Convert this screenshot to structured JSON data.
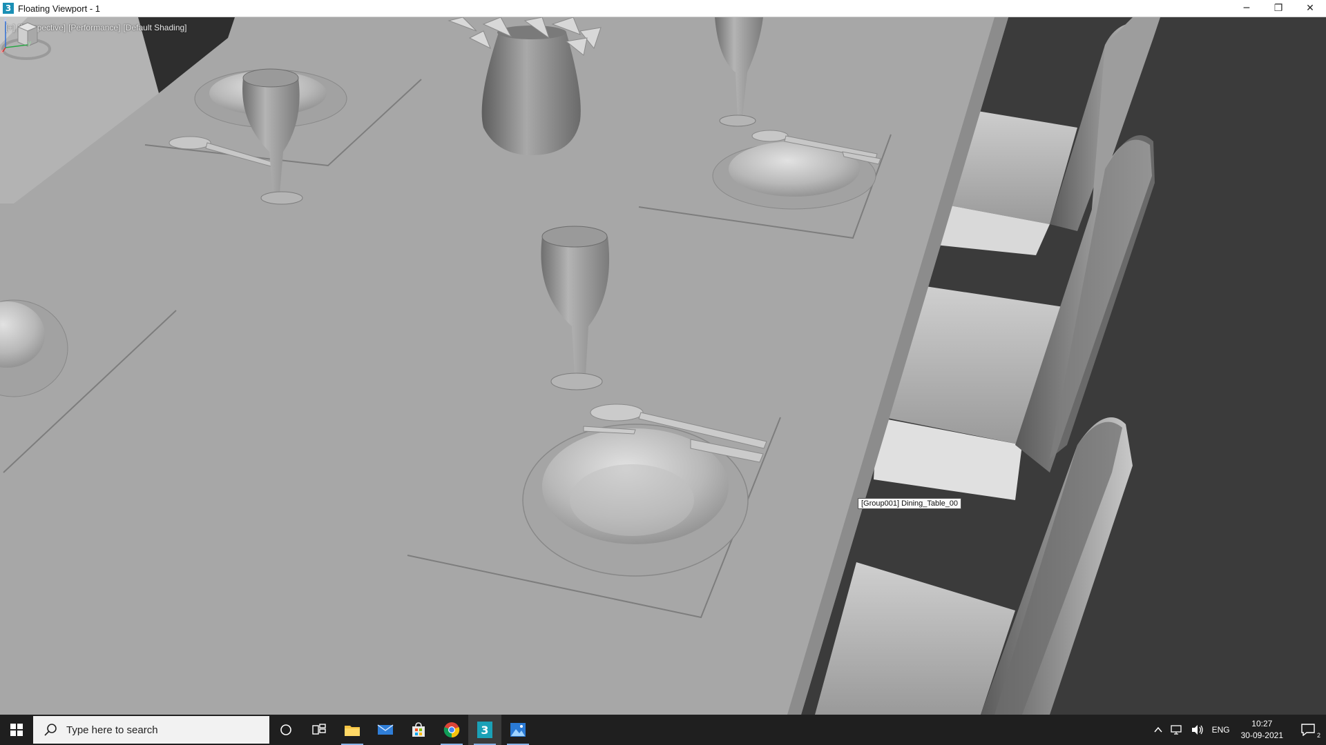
{
  "window": {
    "title": "Floating Viewport - 1",
    "app_icon_glyph": "3",
    "controls": {
      "minimize": "─",
      "restore": "❐",
      "close": "✕"
    }
  },
  "viewport": {
    "labels": [
      "[+]",
      "[Perspective]",
      "[Performance]",
      "[Default Shading]"
    ],
    "tooltip": "[Group001] Dining_Table_00",
    "viewcube_icon": "viewcube-icon",
    "axis": {
      "z": "z",
      "x": "x",
      "y": "y"
    }
  },
  "taskbar": {
    "search_placeholder": "Type here to search",
    "apps": [
      {
        "name": "cortana-icon"
      },
      {
        "name": "task-view-icon"
      },
      {
        "name": "file-explorer-icon"
      },
      {
        "name": "mail-icon"
      },
      {
        "name": "store-icon"
      },
      {
        "name": "chrome-icon"
      },
      {
        "name": "3ds-max-icon",
        "glyph": "3"
      },
      {
        "name": "photos-icon"
      }
    ],
    "tray": {
      "language": "ENG",
      "time": "10:27",
      "date": "30-09-2021",
      "notification_count": "2"
    }
  },
  "colors": {
    "taskbar_bg": "#1f1f1f",
    "viewport_bg": "#3c3c3c",
    "table_surface": "#a9a9a9",
    "accent": "#8ab4e8"
  }
}
